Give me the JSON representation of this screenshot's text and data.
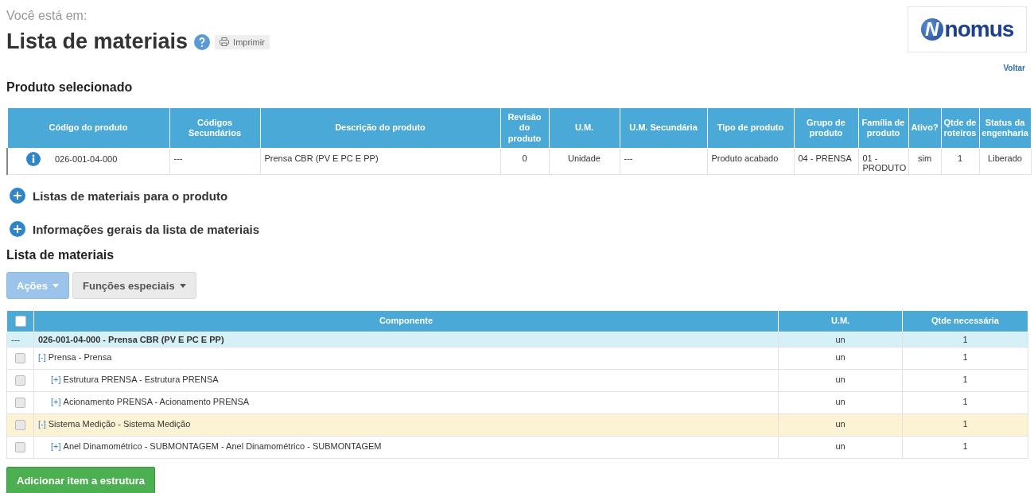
{
  "breadcrumb": "Você está em:",
  "title": "Lista de materiais",
  "print_button": "Imprimir",
  "logo": {
    "mark": "N",
    "text": "nomus"
  },
  "back_link": "Voltar",
  "product_section": {
    "title": "Produto selecionado",
    "columns": [
      "Código do produto",
      "Códigos Secundários",
      "Descrição do produto",
      "Revisão do produto",
      "U.M.",
      "U.M. Secundária",
      "Tipo de produto",
      "Grupo de produto",
      "Família de produto",
      "Ativo?",
      "Qtde de roteiros",
      "Status da engenharia"
    ],
    "row": [
      "026-001-04-000",
      "---",
      "Prensa CBR (PV E PC E PP)",
      "0",
      "Unidade",
      "---",
      "Produto acabado",
      "04 - PRENSA",
      "01 - PRODUTO",
      "sim",
      "1",
      "Liberado"
    ]
  },
  "accordions": [
    {
      "label": "Listas de materiais para o produto",
      "expanded": false
    },
    {
      "label": "Informações gerais da lista de materiais",
      "expanded": false
    }
  ],
  "materials": {
    "title": "Lista de materiais",
    "buttons": [
      {
        "label": "Ações",
        "disabled": true
      },
      {
        "label": "Funções especiais",
        "disabled": false
      }
    ],
    "columns": [
      "Componente",
      "U.M.",
      "Qtde necessária"
    ],
    "header_checkbox": {
      "checked": false
    },
    "root": {
      "marker": "---",
      "component": "026-001-04-000 - Prensa CBR (PV E PC E PP)",
      "um": "un",
      "qty": "1"
    },
    "rows": [
      {
        "toggle": "[-]",
        "component": "Prensa - Prensa",
        "um": "un",
        "qty": "1",
        "checked": false,
        "highlighted": false,
        "children": [
          {
            "toggle": "[+]",
            "component": "Estrutura PRENSA - Estrutura PRENSA",
            "um": "un",
            "qty": "1",
            "checked": false,
            "highlighted": false
          },
          {
            "toggle": "[+]",
            "component": "Acionamento PRENSA - Acionamento PRENSA",
            "um": "un",
            "qty": "1",
            "checked": false,
            "highlighted": false
          }
        ]
      },
      {
        "toggle": "[-]",
        "component": "Sistema Medição - Sistema Medição",
        "um": "un",
        "qty": "1",
        "checked": false,
        "highlighted": true,
        "children": [
          {
            "toggle": "[+]",
            "component": "Anel Dinamométrico - SUBMONTAGEM - Anel Dinamométrico - SUBMONTAGEM",
            "um": "un",
            "qty": "1",
            "checked": false,
            "highlighted": false
          }
        ]
      }
    ],
    "add_button": "Adicionar item a estrutura"
  }
}
